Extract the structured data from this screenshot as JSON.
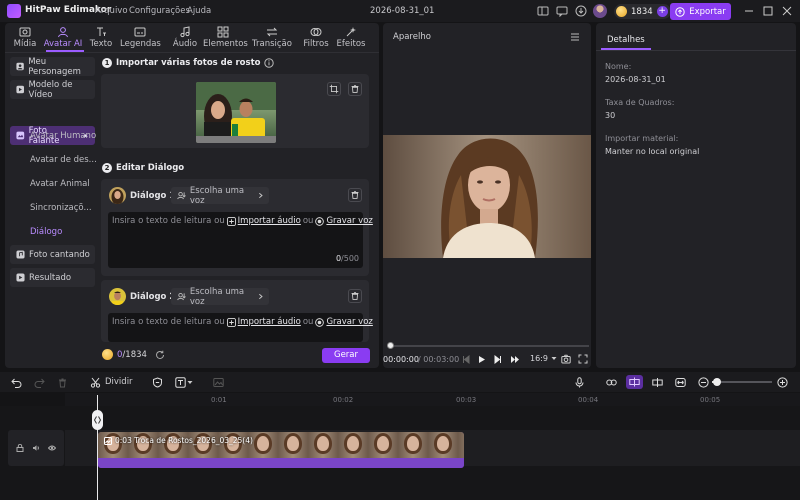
{
  "app": {
    "name": "HitPaw Edimakor",
    "menu": [
      "Arquivo",
      "Configurações",
      "Ajuda"
    ],
    "project_title": "2026-08-31_01",
    "credits": "1834",
    "export_label": "Exportar"
  },
  "tools": [
    {
      "label": "Mídia",
      "icon": "media-icon"
    },
    {
      "label": "Avatar AI",
      "icon": "avatar-ai-icon",
      "active": true
    },
    {
      "label": "Texto",
      "icon": "text-icon"
    },
    {
      "label": "Legendas",
      "icon": "captions-icon"
    },
    {
      "label": "Áudio",
      "icon": "audio-icon"
    },
    {
      "label": "Elementos",
      "icon": "elements-icon"
    },
    {
      "label": "Transição",
      "icon": "transition-icon"
    },
    {
      "label": "Filtros",
      "icon": "filters-icon"
    },
    {
      "label": "Efeitos",
      "icon": "effects-icon"
    }
  ],
  "sidebar": {
    "items": [
      "Meu Personagem",
      "Modelo de Vídeo",
      "Foto Falante"
    ],
    "sub_items": [
      "Avatar Humano",
      "Avatar de des...",
      "Avatar Animal",
      "Sincronizaçõ...",
      "Diálogo"
    ],
    "bottom_items": [
      "Foto cantando",
      "Resultado"
    ]
  },
  "content": {
    "step1_num": "1",
    "step1_title": "Importar várias fotos de rosto",
    "step2_num": "2",
    "step2_title": "Editar Diálogo",
    "dialog1_label": "Diálogo 1",
    "dialog2_label": "Diálogo 2",
    "voice_placeholder": "Escolha uma voz",
    "text_prefix": "Insira o texto de leitura ou",
    "import_audio": "Importar áudio",
    "or": "ou",
    "record_voice": "Gravar voz",
    "char_count_cur": "0",
    "char_count_max": "/500",
    "bottom_credits_cur": "0",
    "bottom_credits_max": "/1834",
    "generate_label": "Gerar"
  },
  "player": {
    "title": "Aparelho",
    "time_current": "00:00:00",
    "time_total": "/ 00:03:00",
    "aspect": "16:9"
  },
  "details": {
    "tab": "Detalhes",
    "name_label": "Nome:",
    "name_value": "2026-08-31_01",
    "fps_label": "Taxa de Quadros:",
    "fps_value": "30",
    "import_label": "Importar material:",
    "import_value": "Manter no local original"
  },
  "timeline": {
    "split_label": "Dividir",
    "ticks": [
      "0:01",
      "00:02",
      "00:03",
      "00:04",
      "00:05"
    ],
    "clip_label": "0:03  Troca de Rostos_2026_03_25(4)"
  }
}
